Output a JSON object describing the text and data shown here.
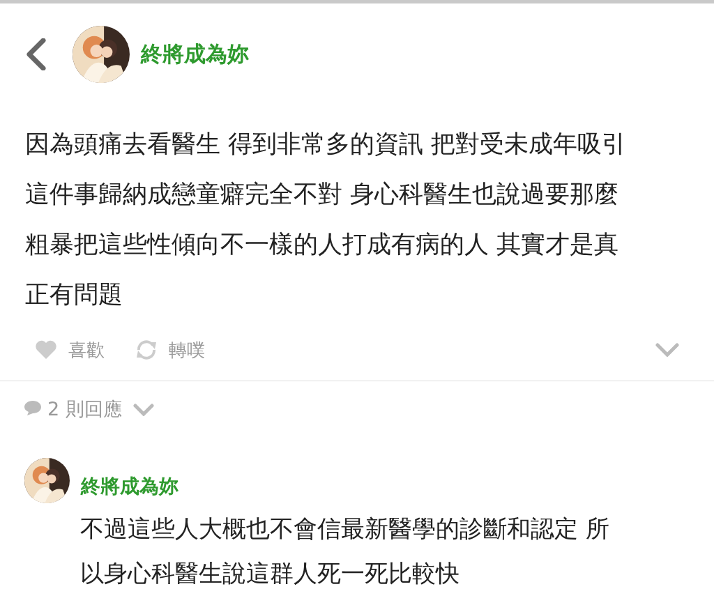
{
  "header": {
    "name": "終將成為妳"
  },
  "post": {
    "lines": [
      "因為頭痛去看醫生 得到非常多的資訊 把對受未成年吸引",
      "這件事歸納成戀童癖完全不對 身心科醫生也說過要那麼",
      "粗暴把這些性傾向不一樣的人打成有病的人 其實才是真",
      "正有問題"
    ],
    "actions": [
      {
        "kind": "like",
        "label": "喜歡"
      },
      {
        "kind": "replurk",
        "label": "轉噗"
      }
    ]
  },
  "responses": {
    "label": "2 則回應"
  },
  "replies": [
    {
      "name": "終將成為妳",
      "lines": [
        "不過這些人大概也不會信最新醫學的診斷和認定 所",
        "以身心科醫生說這群人死一死比較快"
      ]
    }
  ]
}
